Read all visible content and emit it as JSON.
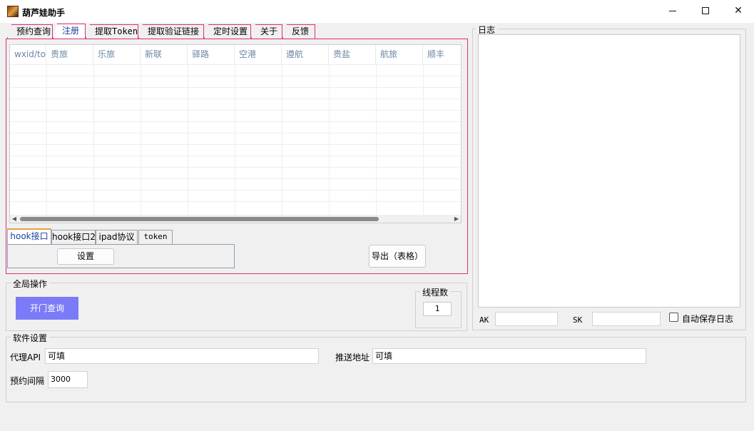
{
  "window": {
    "title": "葫芦娃助手",
    "min_label": "",
    "max_label": "",
    "close_label": "✕"
  },
  "top_tabs": [
    "预约查询",
    "注册",
    "提取Token",
    "提取验证链接",
    "定时设置",
    "关于",
    "反馈"
  ],
  "grid": {
    "columns": [
      "wxid/to",
      "贵旅",
      "乐旅",
      "新联",
      "驿路",
      "空港",
      "遵航",
      "贵盐",
      "航旅",
      "顺丰"
    ]
  },
  "sub_tabs": [
    "hook接口",
    "hook接口2",
    "ipad协议",
    "token"
  ],
  "buttons": {
    "settings": "设置",
    "export": "导出（表格）",
    "open_query": "开门查询"
  },
  "global": {
    "label": "全局操作",
    "threads_label": "线程数",
    "threads_value": "1"
  },
  "log": {
    "label": "日志",
    "ak_label": "AK",
    "sk_label": "SK",
    "ak_value": "",
    "sk_value": "",
    "autosave_label": "自动保存日志"
  },
  "software": {
    "label": "软件设置",
    "proxy_label": "代理API",
    "proxy_value": "可填",
    "push_label": "推送地址",
    "push_value": "可填",
    "interval_label": "预约间隔",
    "interval_value": "3000"
  },
  "colors": {
    "tab_border": "#d9317d",
    "open_button": "#7b7bf7",
    "header_text": "#6b87a5"
  }
}
